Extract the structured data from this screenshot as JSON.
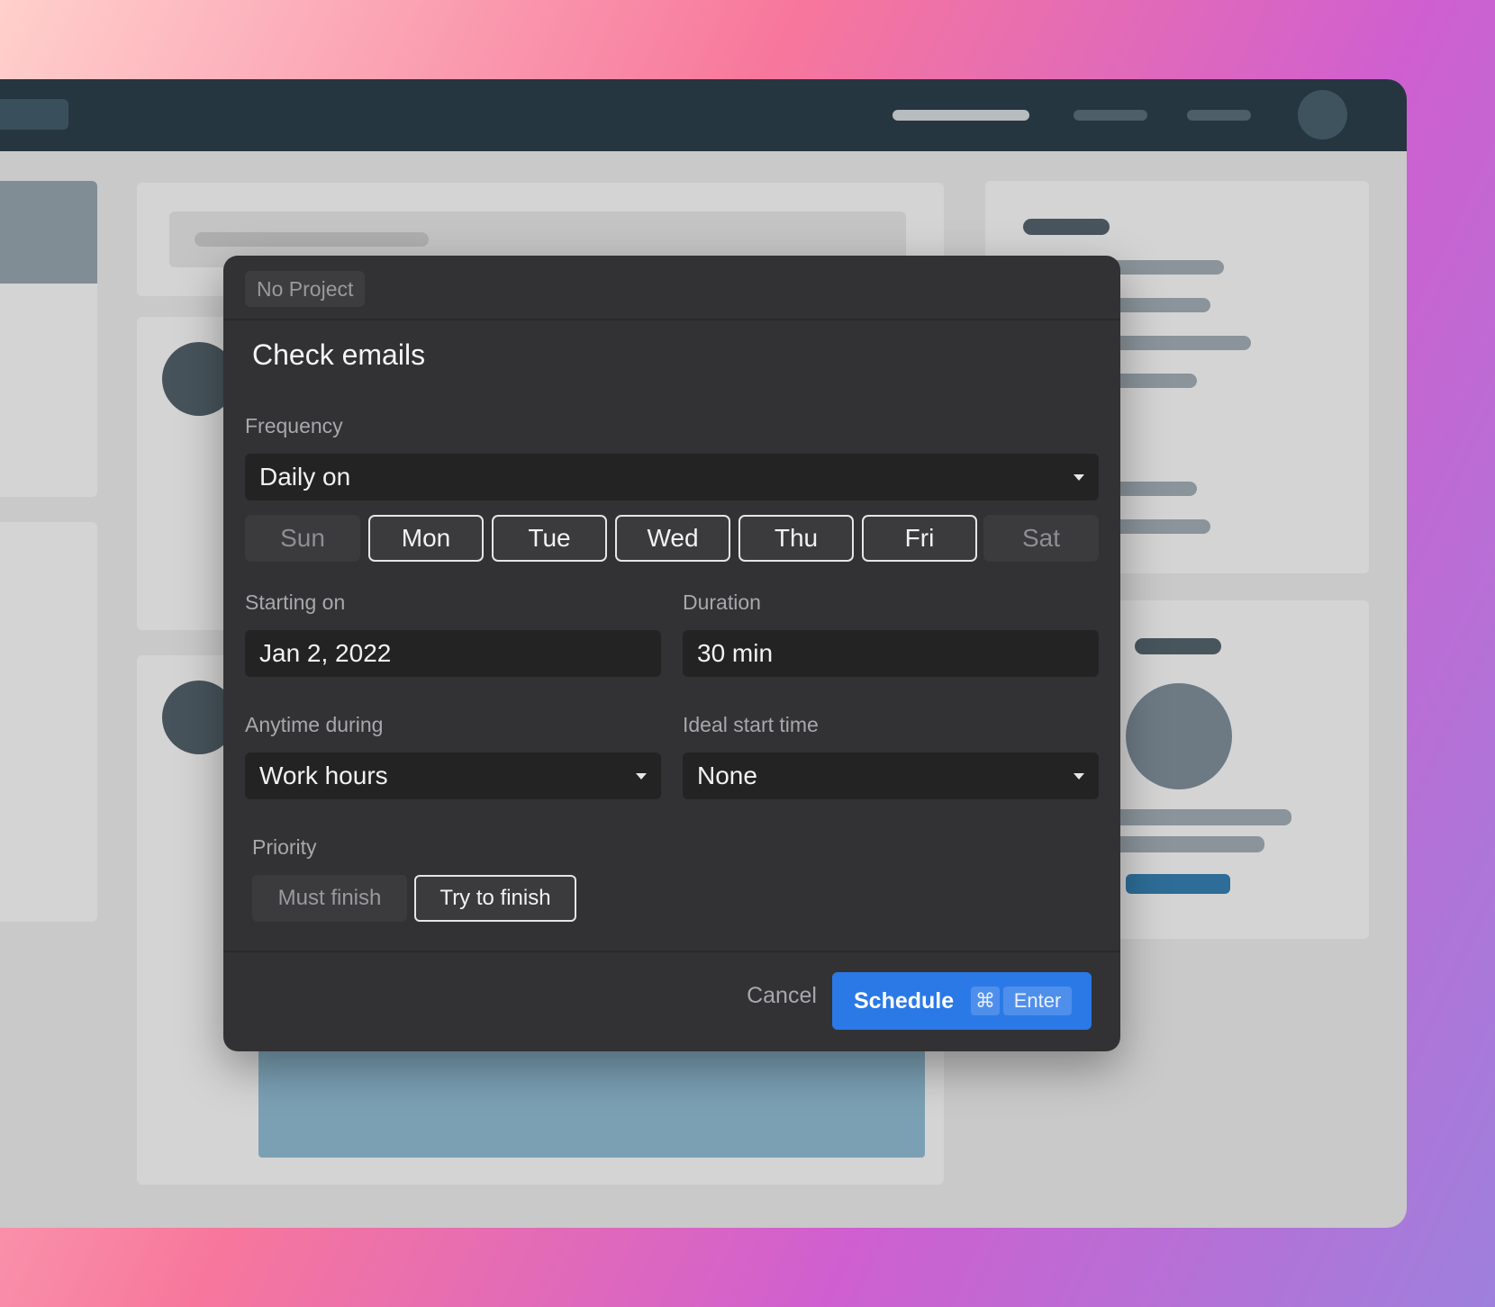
{
  "dialog": {
    "project_tag": "No Project",
    "task_title": "Check emails",
    "frequency": {
      "label": "Frequency",
      "value": "Daily on"
    },
    "days": [
      {
        "label": "Sun",
        "selected": false
      },
      {
        "label": "Mon",
        "selected": true
      },
      {
        "label": "Tue",
        "selected": true
      },
      {
        "label": "Wed",
        "selected": true
      },
      {
        "label": "Thu",
        "selected": true
      },
      {
        "label": "Fri",
        "selected": true
      },
      {
        "label": "Sat",
        "selected": false
      }
    ],
    "starting_on": {
      "label": "Starting on",
      "value": "Jan 2, 2022"
    },
    "duration": {
      "label": "Duration",
      "value": "30 min"
    },
    "anytime_during": {
      "label": "Anytime during",
      "value": "Work hours"
    },
    "ideal_start_time": {
      "label": "Ideal start time",
      "value": "None"
    },
    "priority": {
      "label": "Priority",
      "options": [
        {
          "label": "Must finish",
          "selected": false
        },
        {
          "label": "Try to finish",
          "selected": true
        }
      ]
    },
    "footer": {
      "cancel_label": "Cancel",
      "schedule_label": "Schedule",
      "shortcut_modifier": "⌘",
      "shortcut_key": "Enter"
    }
  },
  "colors": {
    "accent": "#2a79e6",
    "modal_bg": "#323234",
    "field_bg": "#232324"
  }
}
